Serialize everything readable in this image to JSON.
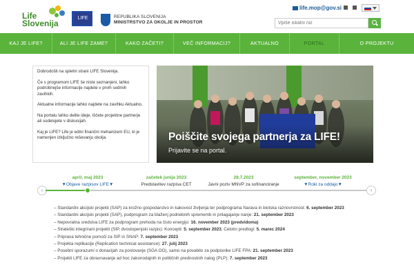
{
  "header": {
    "logo": {
      "line1": "Life",
      "line2": "Slovenija"
    },
    "life_mini_label": "LIFE",
    "ministry": {
      "line1": "REPUBLIKA SLOVENIJA",
      "line2": "MINISTRSTVO ZA OKOLJE IN PROSTOR"
    },
    "contact_email": "life.mop@gov.si",
    "search": {
      "placeholder": "Vpiše iskalni niz"
    }
  },
  "nav": {
    "items": [
      {
        "label": "KAJ JE LIFE?",
        "active": false
      },
      {
        "label": "ALI JE LIFE ZAME?",
        "active": false
      },
      {
        "label": "KAKO ZAČETI?",
        "active": false
      },
      {
        "label": "VEČ INFORMACIJ?",
        "active": false
      },
      {
        "label": "AKTUALNO",
        "active": false
      },
      {
        "label": "PORTAL",
        "active": true
      },
      {
        "label": "O PROJEKTU",
        "active": false
      }
    ]
  },
  "intro": {
    "paragraphs": [
      "Dobrodošli na spletni strani LIFE Slovenija.",
      "Če s programom LIFE še niste seznanjeni, lahko podrobnejše informacije najdete v prvih sedmih zavihkih.",
      "Aktualne informacije lahko najdete na zavihku Aktualno.",
      "Na portalu lahko delite ideje, iščete projektne partnerje ali sodelujete v diskusijah.",
      "Kaj je LIFE? Life je edini finančni mehanizem EU, ki je namenjen izključno reševanju okolja."
    ]
  },
  "banner": {
    "title": "Poiščite svojega partnerja za LIFE!",
    "subtitle": "Prijavite se na portal."
  },
  "timeline": {
    "events": [
      {
        "date": "april, maj 2023",
        "label": "▼Objave razpisov LIFE▼",
        "link": true
      },
      {
        "date": "začetek junija 2023",
        "label": "Predstavitev razpisa CET",
        "link": false
      },
      {
        "date": "28.7.2023",
        "label": "Javni poziv MNVP za sofinanciranje",
        "link": false
      },
      {
        "date": "september, november 2023",
        "label": "▼Roki za oddajo▼",
        "link": true
      }
    ],
    "prev_label": "‹",
    "next_label": "›"
  },
  "deadlines": {
    "items": [
      {
        "text": "– Standardni akcijski projekti (SAP) za krožno gospodarstvo in kakovost življenja ter podprograma Narava in biotska raznovrstnost: ",
        "date": "6. september 2023"
      },
      {
        "text": "– Standardni akcijski projekti (SAP), podprogram za blaženj podnebnih sprememb in prilagajanje nanje: ",
        "date": "21. september 2023"
      },
      {
        "text": "– Nepovratna sredstva LIFE za podprogram prehoda na čisto energijo: ",
        "date": "16. november 2023 (predvidoma)"
      },
      {
        "text": "– Strateški integrirani projekti (SIP, dvostopenjski razpis): Koncepti: ",
        "date": "5. september 2023",
        "extra_text": ", Celotni predlogi: ",
        "extra_date": "5. marec 2024"
      },
      {
        "text": "– Priprava tehnične pomoči za SIP in SNAP: ",
        "date": "7. september 2023"
      },
      {
        "text": "– Projekta replikacije (Replication technical assistance): ",
        "date": "27. julij 2023"
      },
      {
        "text": "– Posebni sporazumi o donacijah za poslovanje (SGA OG), samo na povabilo za podpisnike LIFE FPA: ",
        "date": "21. september 2023"
      },
      {
        "text": "– Projekti LIFE za obravnavanje ad hoc zakonodajnih in političnih prednostnih nalog (PLP): ",
        "date": "7. september 2023"
      }
    ]
  },
  "colors": {
    "brand_green": "#5ab33b",
    "link_blue": "#1a5c9b",
    "eu_blue": "#1f4aa8"
  }
}
